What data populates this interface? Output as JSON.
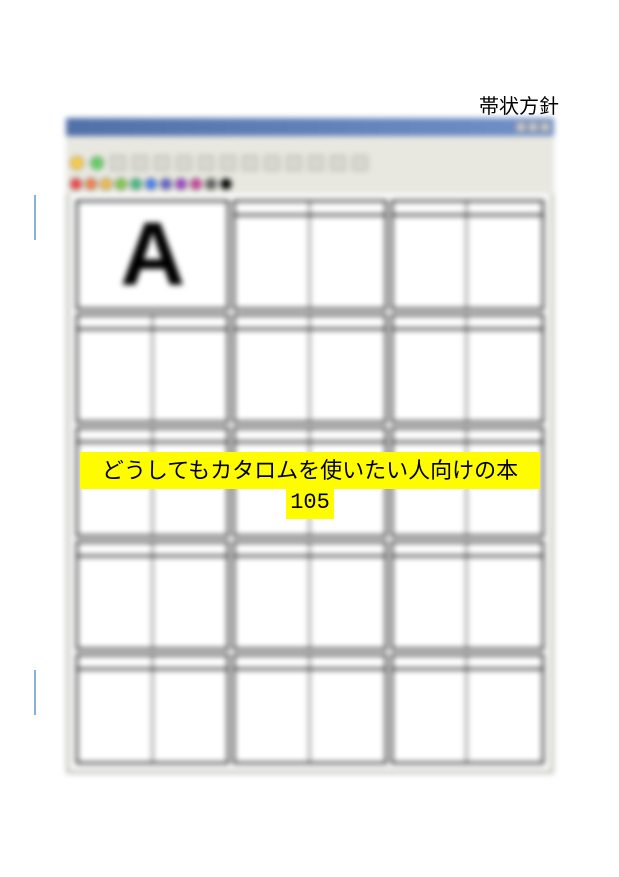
{
  "header": {
    "label": "帯状方針"
  },
  "screenshot": {
    "big_letter": "A",
    "palette_colors": [
      "#ff4040",
      "#ff8040",
      "#ffc040",
      "#80d040",
      "#40c080",
      "#4080ff",
      "#6060d0",
      "#a040d0",
      "#d040a0",
      "#606060",
      "#000000"
    ]
  },
  "overlay": {
    "line1": "どうしてもカタロムを使いたい人向けの本",
    "page_number": "105"
  }
}
